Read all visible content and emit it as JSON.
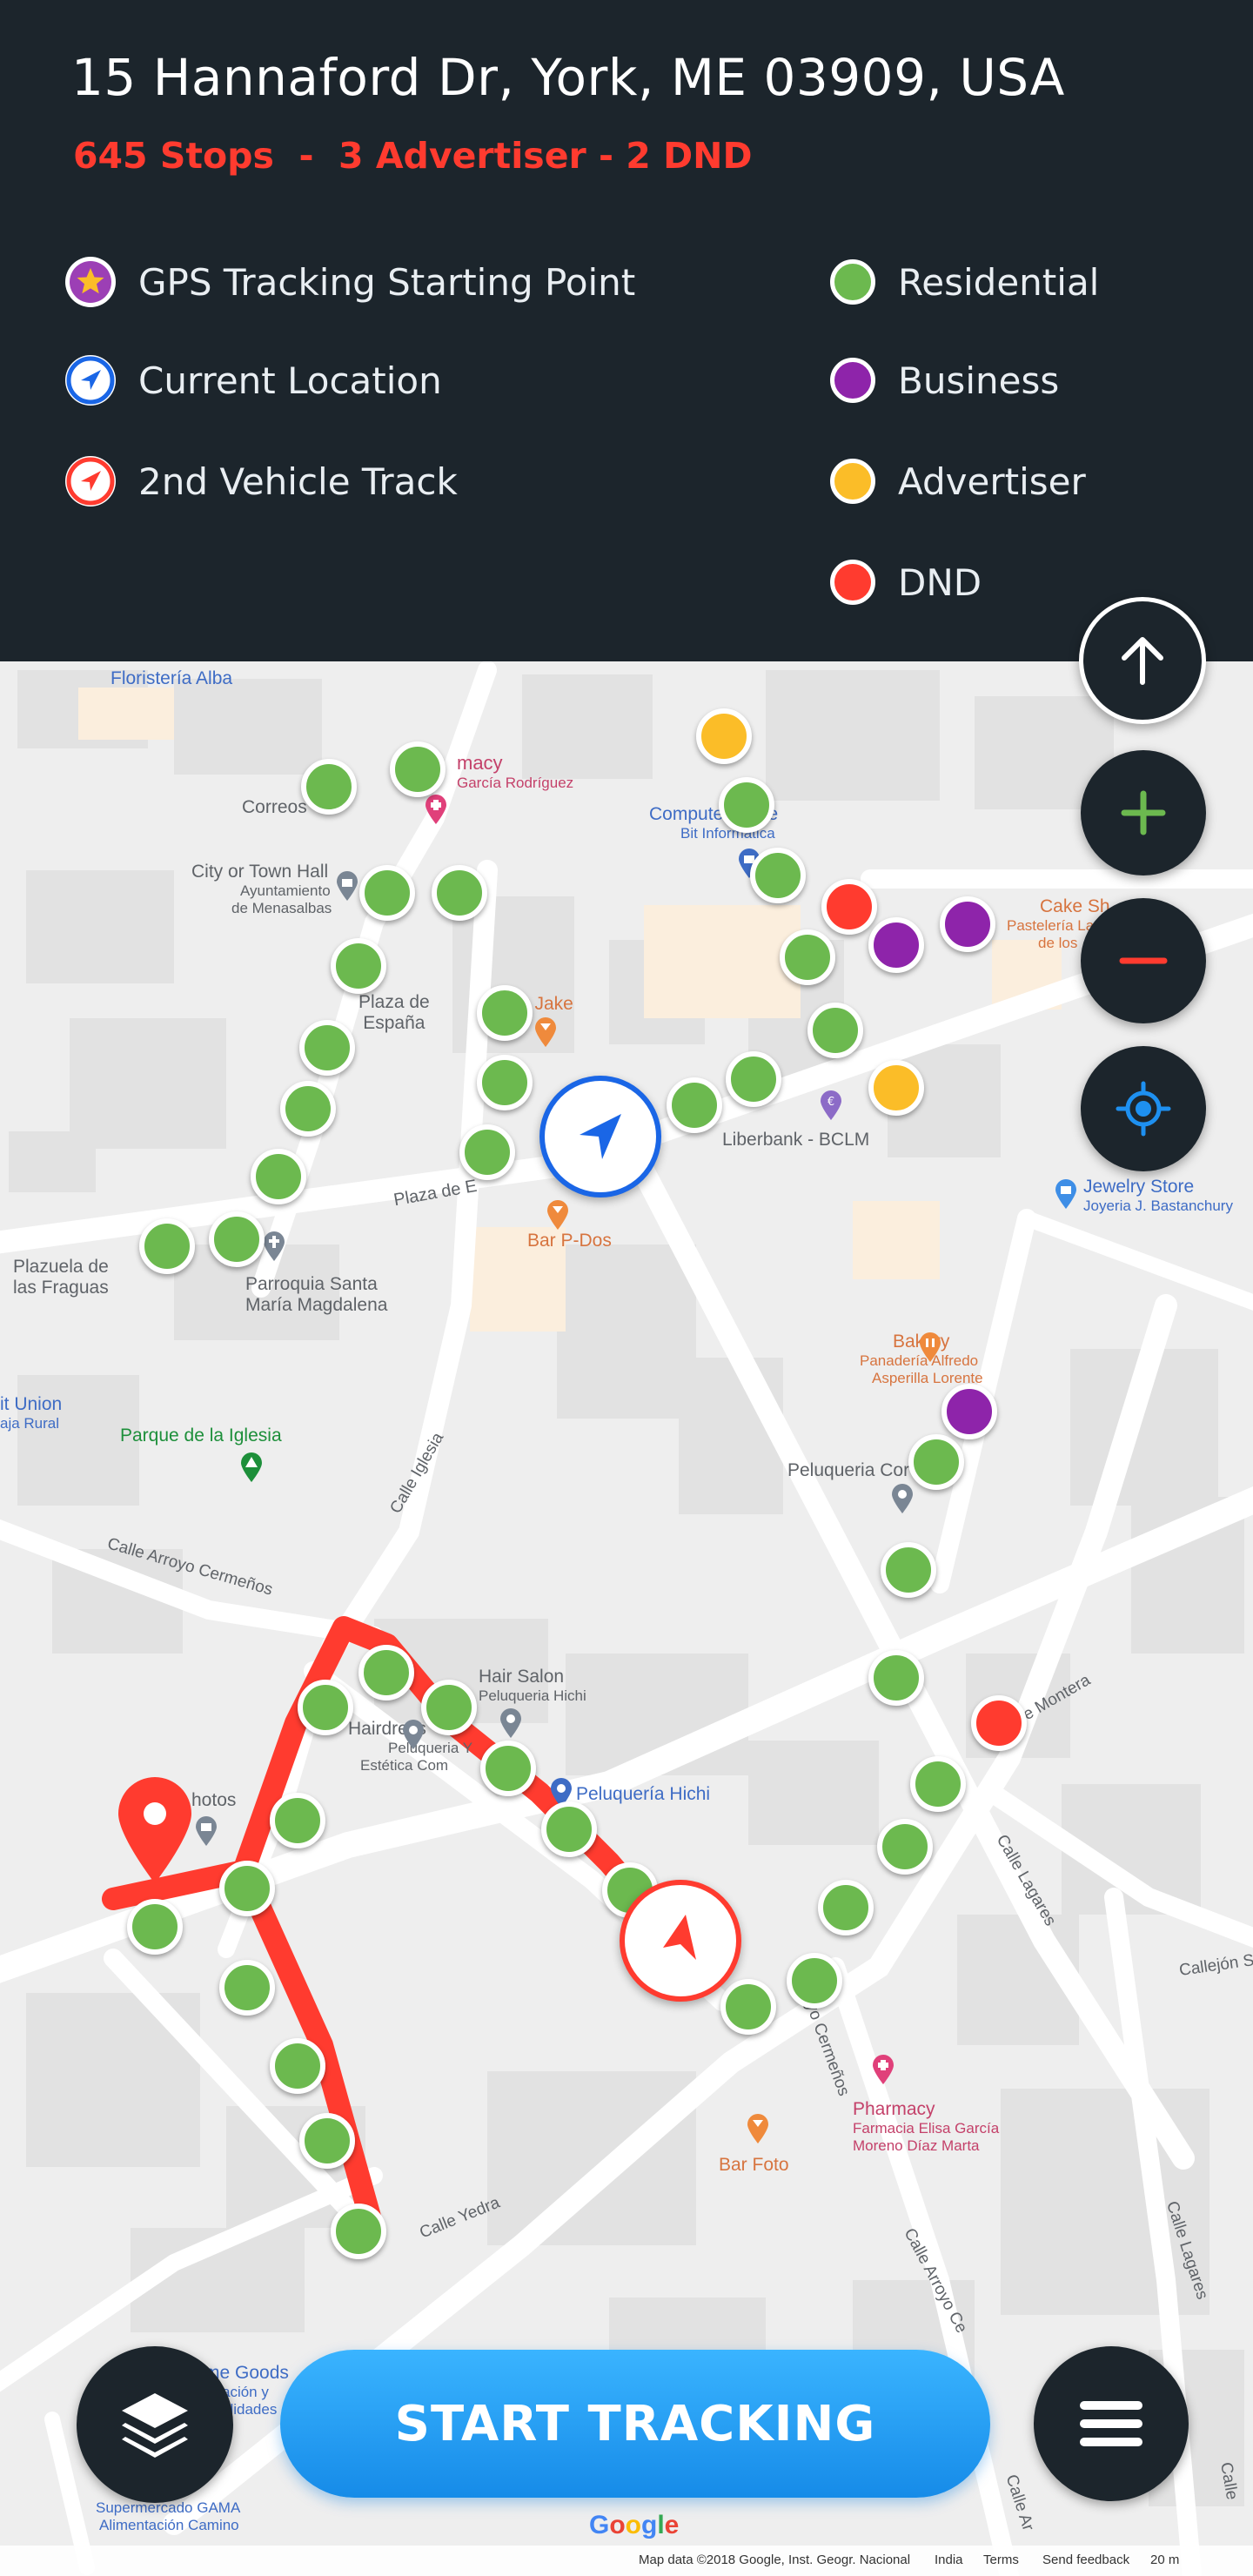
{
  "header": {
    "address": "15 Hannaford Dr, York, ME 03909, USA",
    "stats": "645 Stops  -  3 Advertiser - 2 DND"
  },
  "legend": {
    "left": [
      {
        "label": "GPS Tracking Starting Point",
        "icon": "star-icon"
      },
      {
        "label": "Current Location",
        "icon": "blue-navigation-arrow-icon"
      },
      {
        "label": "2nd Vehicle Track",
        "icon": "red-navigation-arrow-icon"
      }
    ],
    "right": [
      {
        "label": "Residential",
        "color": "#6cb94f"
      },
      {
        "label": "Business",
        "color": "#8e24aa"
      },
      {
        "label": "Advertiser",
        "color": "#fbbd28"
      },
      {
        "label": "DND",
        "color": "#ff3b2f"
      }
    ]
  },
  "colors": {
    "header_bg": "#1c252c",
    "residential": "#6cb94f",
    "business": "#8e24aa",
    "advertiser": "#fbbd28",
    "dnd": "#ff3b2f",
    "current_location": "#1a66e6",
    "track": "#ff3b2f",
    "accent_blue": "#1e90f0"
  },
  "map": {
    "places": {
      "floristeria": "Floristería Alba",
      "farmacia_top": "macy",
      "farmacia_top_sub": "García Rodríguez",
      "correos": "Correos",
      "computer_store": "Computer Store",
      "computer_store_sub": "Bit Informatica",
      "city_hall": "City or Town Hall",
      "city_hall_sub1": "Ayuntamiento",
      "city_hall_sub2": "de Menasalbas",
      "plaza_espana1": "Plaza de",
      "plaza_espana2": "España",
      "bar_jake": "ar Jake",
      "cake_shop": "Cake Sh",
      "cake_shop_sub1": "Pastelería La",
      "cake_shop_sub2": "de los",
      "liberbank": "Liberbank - BCLM",
      "jewelry": "Jewelry Store",
      "jewelry_sub": "Joyeria J. Bastanchury",
      "plaza_de_street": "Plaza de E",
      "bar_pdos": "Bar P-Dos",
      "plazuela1": "Plazuela de",
      "plazuela2": "las Fraguas",
      "parroquia1": "Parroquia Santa",
      "parroquia2": "María Magdalena",
      "bakery": "Bakery",
      "bakery_sub1": "Panadería Alfredo",
      "bakery_sub2": "Asperilla Lorente",
      "union1": "it Union",
      "union2": "aja Rural",
      "parque": "Parque de la Iglesia",
      "peluqueria_cor": "Peluqueria Cor",
      "calle_iglesia": "Calle Iglesia",
      "calle_arroyo": "Calle Arroyo Cermeños",
      "hair_salon": "Hair Salon",
      "hair_salon_sub": "Peluqueria Hichi",
      "hairdresser": "Hairdress",
      "hairdresser_sub1": "Peluqueria Y",
      "hairdresser_sub2": "Estética Com",
      "peluqueria_hichi": "Peluquería Hichi",
      "photos": "hotos",
      "monte": "e Montera",
      "calle_lagares": "Calle Lagares",
      "callejon": "Callejón S",
      "arroyo_vertical": "e Arroyo Cermeños",
      "pharmacy": "Pharmacy",
      "pharmacy_sub1": "Farmacia Elisa García",
      "pharmacy_sub2": "Moreno Díaz Marta",
      "bar_foto": "Bar Foto",
      "calle_yedra": "Calle Yedra",
      "calle_arroyo_ce": "Calle Arroyo Ce",
      "calle_lagares2": "Calle Lagares",
      "goods": "me Goods",
      "goods_sub1": "ación y",
      "goods_sub2": "alidades",
      "gama": "Supermercado GAMA",
      "gama_sub": "Alimentación Camino",
      "calle_ar_bottom": "Calle Ar",
      "calle_bottom_right": "Calle"
    },
    "google_logo": "Google",
    "attribution": {
      "data": "Map data ©2018 Google, Inst. Geogr. Nacional",
      "region": "India",
      "terms": "Terms",
      "feedback": "Send feedback",
      "scale": "20 m"
    }
  },
  "controls": {
    "north": "north-arrow-icon",
    "zoom_in": "plus-icon",
    "zoom_out": "minus-icon",
    "locate": "crosshair-locate-icon",
    "layers": "layers-icon",
    "menu": "hamburger-menu-icon"
  },
  "start_button": "START TRACKING"
}
